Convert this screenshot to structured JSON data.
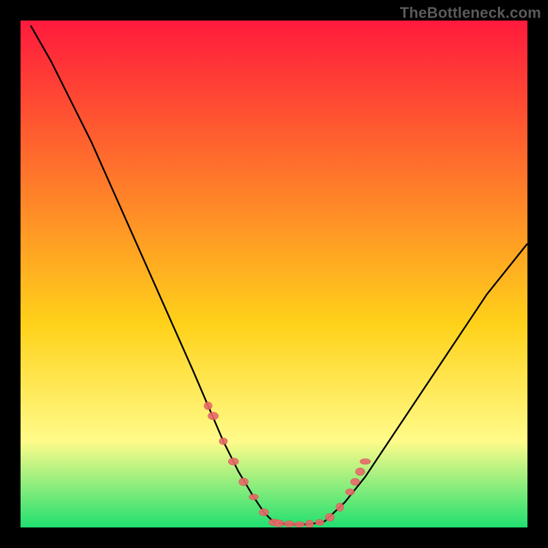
{
  "watermark": "TheBottleneck.com",
  "colors": {
    "gradient_top": "#ff1a3c",
    "gradient_mid1": "#ff7a2a",
    "gradient_mid2": "#ffd21a",
    "gradient_mid3": "#fffb8a",
    "gradient_bottom": "#20e070",
    "curve": "#000000",
    "marker_fill": "#e86a6a",
    "marker_stroke": "#d24f4f",
    "frame": "#000000"
  },
  "chart_data": {
    "type": "line",
    "title": "",
    "xlabel": "",
    "ylabel": "",
    "xlim": [
      0,
      100
    ],
    "ylim": [
      0,
      100
    ],
    "grid": false,
    "legend": false,
    "series": [
      {
        "name": "bottleneck-curve-left",
        "x": [
          2,
          6,
          10,
          14,
          18,
          22,
          26,
          30,
          34,
          37,
          40,
          43,
          46,
          48,
          50
        ],
        "y": [
          99,
          92,
          84,
          76,
          67,
          58,
          49,
          40,
          31,
          24,
          17,
          11,
          6,
          3,
          1
        ]
      },
      {
        "name": "bottleneck-curve-flat",
        "x": [
          50,
          52,
          54,
          56,
          58,
          60
        ],
        "y": [
          1,
          0.7,
          0.6,
          0.6,
          0.8,
          1.2
        ]
      },
      {
        "name": "bottleneck-curve-right",
        "x": [
          60,
          64,
          68,
          72,
          76,
          80,
          84,
          88,
          92,
          96,
          100
        ],
        "y": [
          1.2,
          5,
          10,
          16,
          22,
          28,
          34,
          40,
          46,
          51,
          56
        ]
      }
    ],
    "markers": {
      "name": "sample-points",
      "x": [
        37,
        38,
        40,
        42,
        44,
        46,
        48,
        50,
        51,
        53,
        55,
        57,
        59,
        61,
        63,
        65,
        66,
        67,
        68
      ],
      "y": [
        24,
        22,
        17,
        13,
        9,
        6,
        3,
        1,
        0.8,
        0.7,
        0.6,
        0.7,
        1,
        2,
        4,
        7,
        9,
        11,
        13
      ]
    }
  }
}
